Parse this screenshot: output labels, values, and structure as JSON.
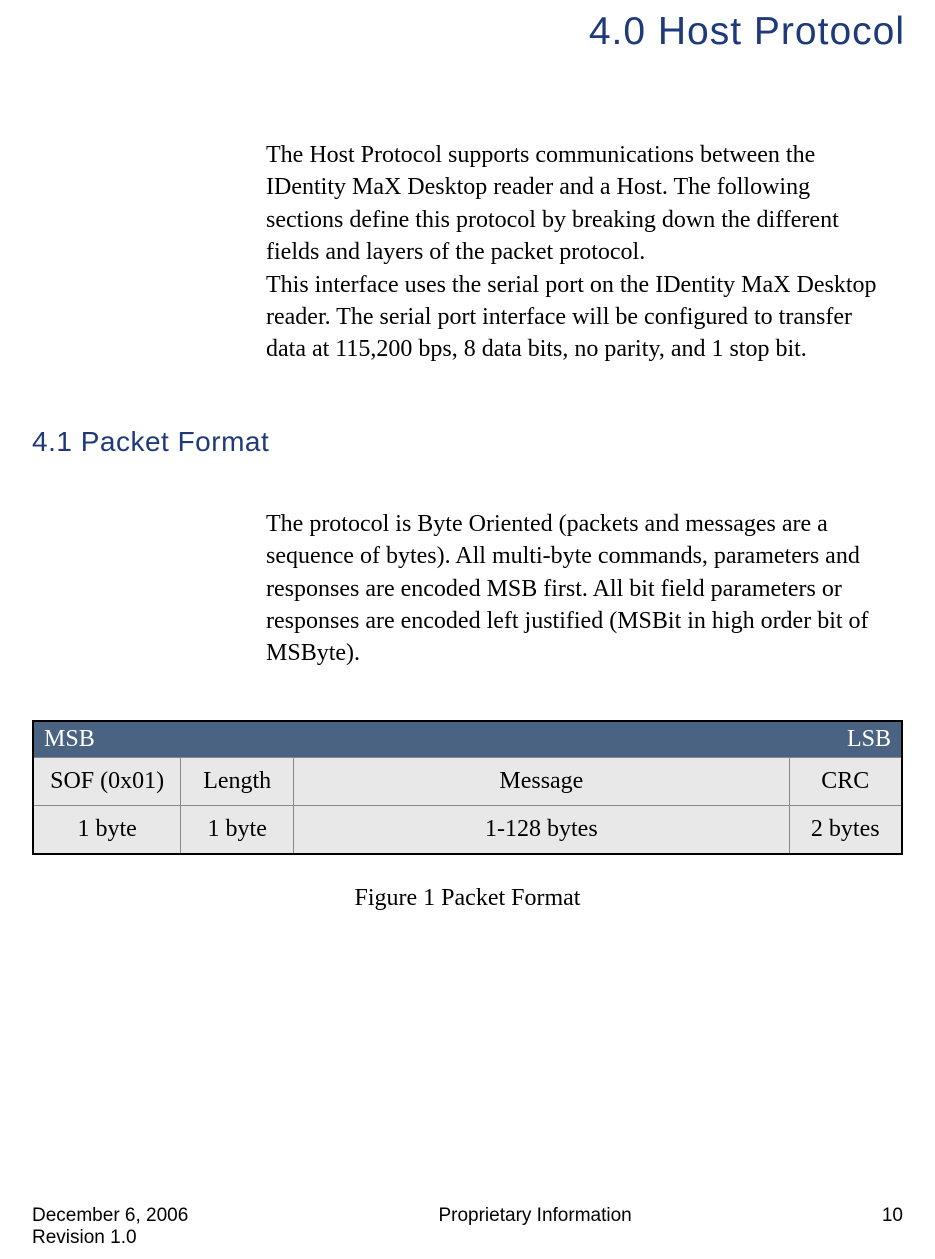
{
  "heading": {
    "main": "4.0 Host Protocol",
    "sub": "4.1  Packet Format"
  },
  "paragraphs": {
    "intro": "The Host Protocol supports communications between the IDentity MaX Desktop reader and a Host.  The following sections define this protocol by breaking down the different fields and layers of the packet protocol.\nThis interface uses the serial port on the IDentity MaX Desktop reader.  The serial port interface will be configured to transfer data at 115,200 bps, 8 data bits, no parity, and 1 stop bit.",
    "packet_format": "The protocol is Byte Oriented (packets and messages are a sequence of bytes).  All multi-byte commands, parameters and responses are encoded MSB first.  All bit field parameters or responses are encoded left justified (MSBit in high order bit of MSByte)."
  },
  "table": {
    "header_left": "MSB",
    "header_right": "LSB",
    "row1": {
      "sof": "SOF (0x01)",
      "length": "Length",
      "message": "Message",
      "crc": "CRC"
    },
    "row2": {
      "sof": "1 byte",
      "length": "1 byte",
      "message": "1-128 bytes",
      "crc": "2 bytes"
    }
  },
  "figure_caption": "Figure 1 Packet Format",
  "footer": {
    "date": "December 6, 2006",
    "revision": "Revision 1.0",
    "center": "Proprietary Information",
    "page": "10"
  }
}
